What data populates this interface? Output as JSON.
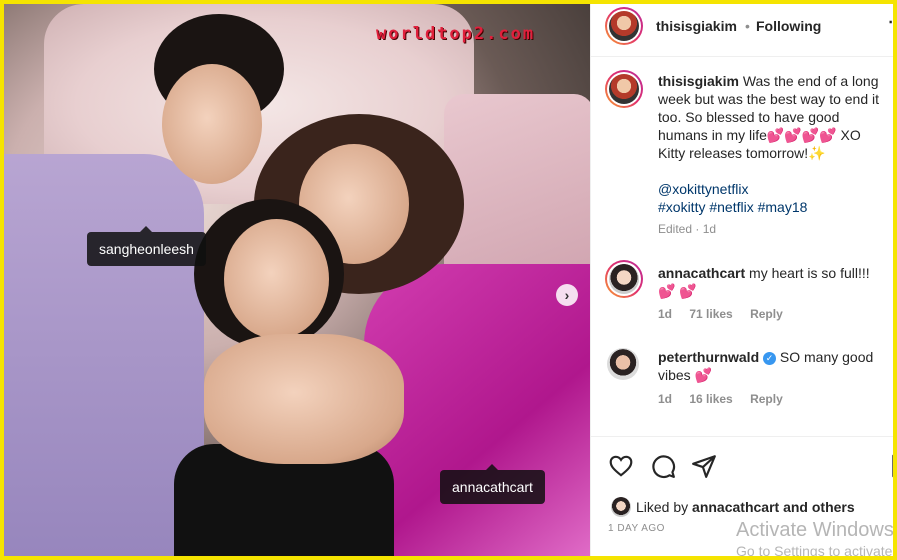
{
  "watermark": "worldtop2.com",
  "photo": {
    "tags": [
      "sangheonleesh",
      "annacathcart"
    ],
    "next_icon": "chevron-right-icon"
  },
  "header": {
    "username": "thisisgiakim",
    "separator": "•",
    "follow_status": "Following",
    "more_icon": "more-icon"
  },
  "caption": {
    "username": "thisisgiakim",
    "text": "Was the end of a long week but was the best way to end it too. So blessed to have good humans in my life💕💕💕💕 XO Kitty releases tomorrow!",
    "sparkle": "✨",
    "mention": "@xokittynetflix",
    "hashtags": "#xokitty #netflix #may18",
    "edited": "Edited",
    "edited_separator": "·",
    "age": "1d"
  },
  "comments": [
    {
      "username": "annacathcart",
      "text": "my heart is so full!!! 💕 💕",
      "verified": false,
      "age": "1d",
      "likes": "71 likes",
      "reply": "Reply"
    },
    {
      "username": "peterthurnwald",
      "text": "SO many good vibes 💕",
      "verified": true,
      "age": "1d",
      "likes": "16 likes",
      "reply": "Reply"
    }
  ],
  "actions": {
    "like_icon": "heart-icon",
    "comment_icon": "comment-icon",
    "share_icon": "share-icon",
    "save_icon": "bookmark-icon"
  },
  "likes": {
    "prefix": "Liked by",
    "user": "annacathcart",
    "suffix": "and others"
  },
  "post_date": "1 DAY AGO",
  "os_overlay": {
    "title": "Activate Windows",
    "subtitle": "Go to Settings to activate"
  },
  "colors": {
    "frame": "#f5e400",
    "link": "#00376b",
    "verified": "#3897f0",
    "muted": "#8e8e8e"
  }
}
